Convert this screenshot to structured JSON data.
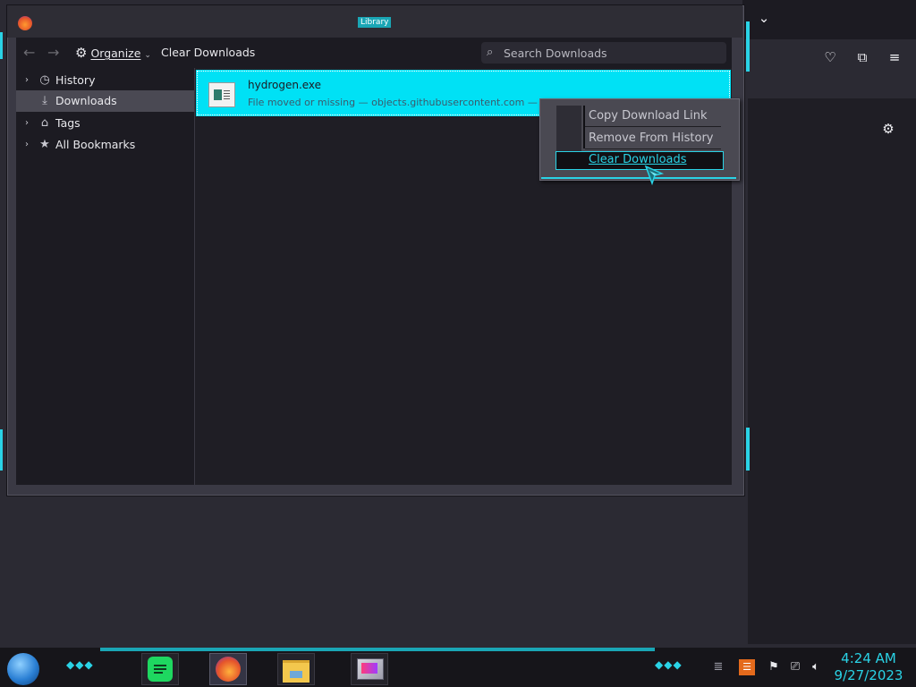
{
  "library": {
    "window_title": "Library",
    "toolbar": {
      "back_label": "←",
      "forward_label": "→",
      "organize_label": "Organize",
      "clear_label": "Clear Downloads",
      "search_placeholder": "Search Downloads"
    },
    "sidebar": {
      "items": [
        {
          "label": "History",
          "icon": "clock-icon",
          "expandable": true
        },
        {
          "label": "Downloads",
          "icon": "download-icon",
          "selected": true
        },
        {
          "label": "Tags",
          "icon": "tag-icon",
          "expandable": true
        },
        {
          "label": "All Bookmarks",
          "icon": "star-icon",
          "expandable": true
        }
      ]
    },
    "downloads": [
      {
        "name": "hydrogen.exe",
        "status": "File moved or missing — objects.githubusercontent.com — 4:20"
      }
    ]
  },
  "context_menu": {
    "items": [
      {
        "label": "Copy Download Link",
        "access_key": "L"
      },
      {
        "label": "Remove From History",
        "access_key": "e"
      },
      {
        "label": "Clear Downloads",
        "access_key": "D",
        "active": true
      }
    ]
  },
  "taskbar": {
    "time": "4:24 AM",
    "date": "9/27/2023",
    "apps": [
      "spotify-icon",
      "firefox-icon",
      "file-explorer-icon",
      "media-app-icon"
    ]
  },
  "colors": {
    "accent_cyan": "#2ad3e6",
    "selected_row": "#00e1f5",
    "window_bg": "#1c1b22"
  }
}
